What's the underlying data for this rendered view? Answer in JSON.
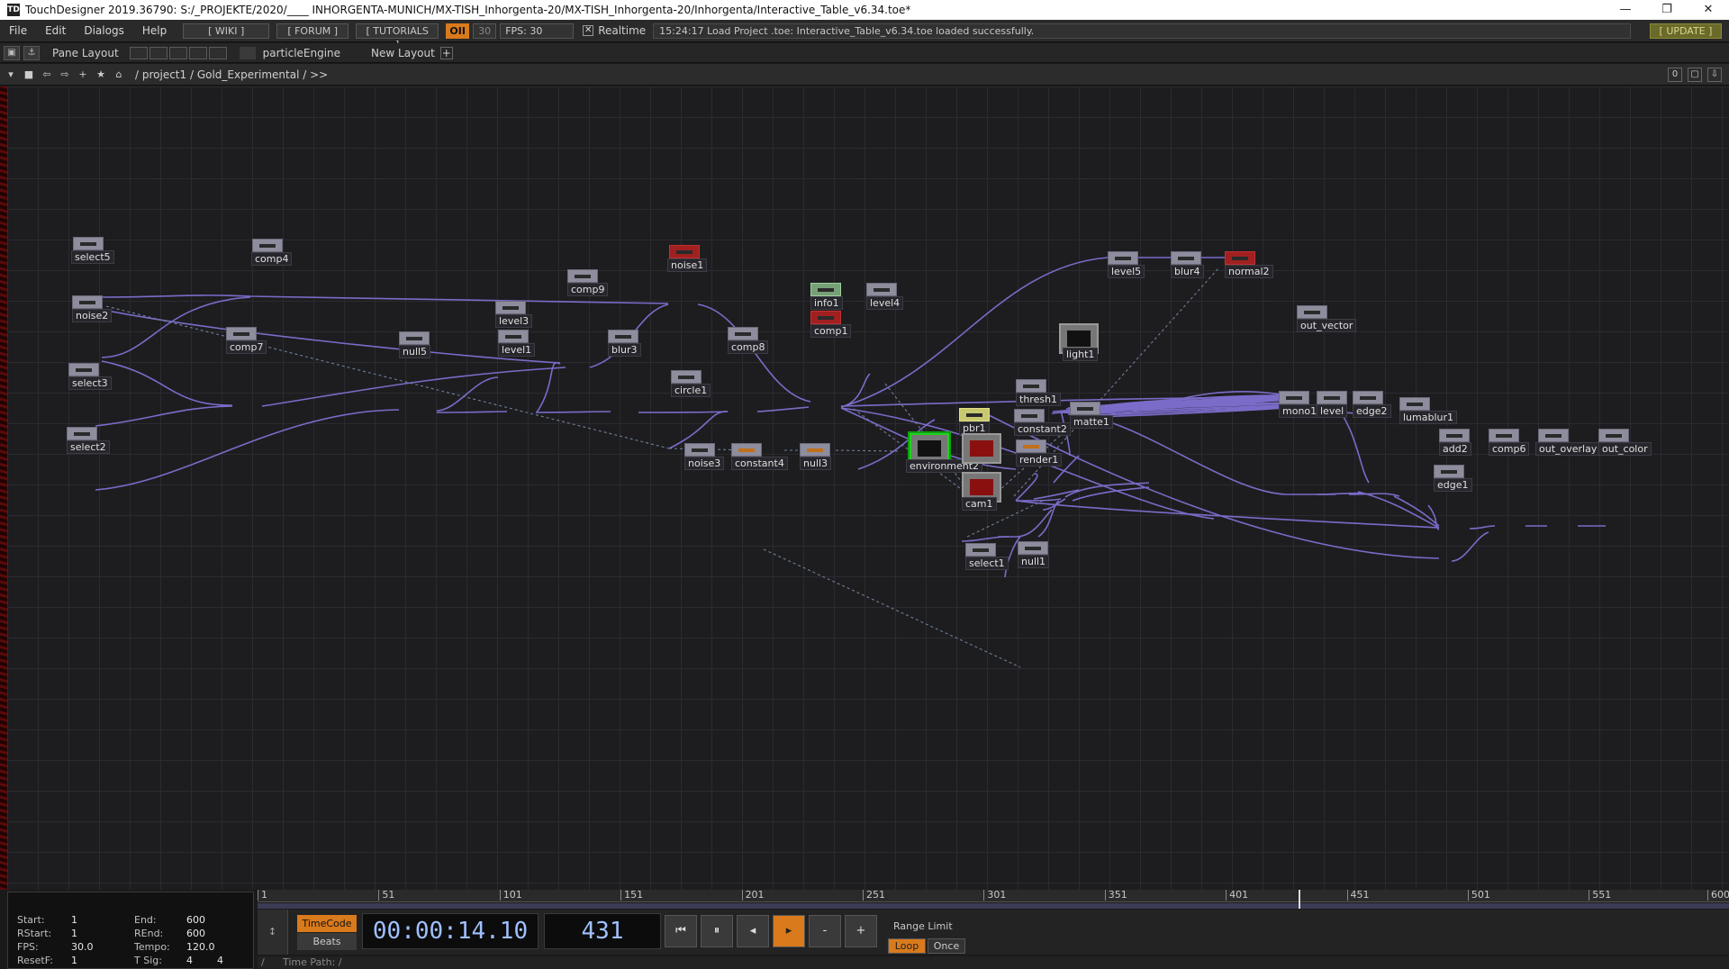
{
  "window": {
    "app_icon": "TD",
    "title": "TouchDesigner 2019.36790: S:/_PROJEKTE/2020/____ INHORGENTA-MUNICH/MX-TISH_Inhorgenta-20/MX-TISH_Inhorgenta-20/Inhorgenta/Interactive_Table_v6.34.toe*",
    "minimize": "—",
    "restore": "❐",
    "close": "✕"
  },
  "menubar": {
    "file": "File",
    "edit": "Edit",
    "dialogs": "Dialogs",
    "help": "Help",
    "wiki": "[ WIKI ]",
    "forum": "[ FORUM ]",
    "tutorials": "[ TUTORIALS ]",
    "oi": "OII",
    "fps_target": "30",
    "fps_display": "FPS: 30",
    "realtime_check": "✕",
    "realtime_label": "Realtime",
    "status": "15:24:17 Load Project .toe: Interactive_Table_v6.34.toe loaded successfully.",
    "update": "[ UPDATE ]"
  },
  "panebar": {
    "pane_layout": "Pane Layout",
    "pane_name": "particleEngine",
    "new_layout": "New Layout",
    "plus": "+"
  },
  "pathbar": {
    "path": "/ project1 / Gold_Experimental / >>",
    "zero": "0"
  },
  "nodes": [
    {
      "label": "select5"
    },
    {
      "label": "comp4"
    },
    {
      "label": "noise1"
    },
    {
      "label": "noise2"
    },
    {
      "label": "comp9"
    },
    {
      "label": "level3"
    },
    {
      "label": "comp7"
    },
    {
      "label": "null5"
    },
    {
      "label": "level1"
    },
    {
      "label": "blur3"
    },
    {
      "label": "comp8"
    },
    {
      "label": "select3"
    },
    {
      "label": "circle1"
    },
    {
      "label": "select2"
    },
    {
      "label": "info1"
    },
    {
      "label": "level4"
    },
    {
      "label": "comp1"
    },
    {
      "label": "level5"
    },
    {
      "label": "blur4"
    },
    {
      "label": "normal2"
    },
    {
      "label": "out_vector"
    },
    {
      "label": "light1"
    },
    {
      "label": "thresh1"
    },
    {
      "label": "pbr1"
    },
    {
      "label": "constant2"
    },
    {
      "label": "matte1"
    },
    {
      "label": "mono1"
    },
    {
      "label": "level"
    },
    {
      "label": "edge2"
    },
    {
      "label": "lumablur1"
    },
    {
      "label": "noise3"
    },
    {
      "label": "constant4"
    },
    {
      "label": "null3"
    },
    {
      "label": "environment2"
    },
    {
      "label": "render1"
    },
    {
      "label": "add2"
    },
    {
      "label": "comp6"
    },
    {
      "label": "out_overlay"
    },
    {
      "label": "out_color"
    },
    {
      "label": "edge1"
    },
    {
      "label": "cam1"
    },
    {
      "label": "select1"
    },
    {
      "label": "null1"
    }
  ],
  "timeinfo": {
    "start_label": "Start:",
    "start": "1",
    "end_label": "End:",
    "end": "600",
    "rstart_label": "RStart:",
    "rstart": "1",
    "rend_label": "REnd:",
    "rend": "600",
    "fps_label": "FPS:",
    "fps": "30.0",
    "tempo_label": "Tempo:",
    "tempo": "120.0",
    "resetf_label": "ResetF:",
    "resetf": "1",
    "tsig_label": "T Sig:",
    "tsig_a": "4",
    "tsig_b": "4"
  },
  "ruler": {
    "ticks": [
      "1",
      "51",
      "101",
      "151",
      "201",
      "251",
      "301",
      "351",
      "401",
      "451",
      "501",
      "551",
      "600"
    ],
    "current_frame": 431
  },
  "transport": {
    "timecode": "TimeCode",
    "beats": "Beats",
    "time": "00:00:14.10",
    "frame": "431",
    "rewind": "⏮",
    "pause": "⏸",
    "step_back": "◂",
    "play": "▸",
    "minus": "-",
    "plus": "+",
    "range_limit": "Range Limit",
    "loop": "Loop",
    "once": "Once"
  },
  "timepath": {
    "slash": "/",
    "label": "Time Path: /"
  },
  "colors": {
    "accent_orange": "#d97a1c",
    "wire": "#7a6cc8",
    "grid": "#2b2b30",
    "selected": "#20d020"
  }
}
